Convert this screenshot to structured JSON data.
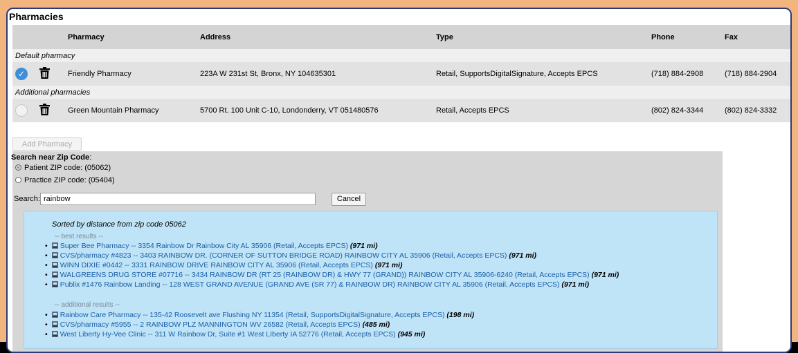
{
  "title": "Pharmacies",
  "columns": [
    "Pharmacy",
    "Address",
    "Type",
    "Phone",
    "Fax"
  ],
  "sections": {
    "default_label": "Default pharmacy",
    "additional_label": "Additional pharmacies"
  },
  "pharmacies": [
    {
      "name": "Friendly Pharmacy",
      "address": "223A W 231st St, Bronx, NY 104635301",
      "type": "Retail, SupportsDigitalSignature, Accepts EPCS",
      "phone": "(718) 884-2908",
      "fax": "(718) 884-2904",
      "selected": true
    },
    {
      "name": "Green Mountain Pharmacy",
      "address": "5700 Rt. 100 Unit C-10, Londonderry, VT 051480576",
      "type": "Retail, Accepts EPCS",
      "phone": "(802) 824-3344",
      "fax": "(802) 824-3332",
      "selected": false
    }
  ],
  "add_pharmacy_label": "Add Pharmacy",
  "search": {
    "heading": "Search near Zip Code",
    "colon": ":",
    "patient_zip": "Patient ZIP code: (05062)",
    "practice_zip": "Practice ZIP code: (05404)",
    "label": "Search:",
    "value": "rainbow",
    "cancel_label": "Cancel"
  },
  "results": {
    "sorted_text": "Sorted by distance from zip code 05062",
    "best_label": "-- best results --",
    "additional_label": "-- additional results --",
    "best": [
      {
        "text": "Super Bee Pharmacy -- 3354 Rainbow Dr Rainbow City AL 35906 (Retail, Accepts EPCS)",
        "distance": "(971 mi)"
      },
      {
        "text": "CVS/pharmacy #4823 -- 3403 RAINBOW DR. (CORNER OF SUTTON BRIDGE ROAD) RAINBOW CITY AL 35906 (Retail, Accepts EPCS)",
        "distance": "(971 mi)"
      },
      {
        "text": "WINN DIXIE #0442 -- 3331 RAINBOW DRIVE RAINBOW CITY AL 35906 (Retail, Accepts EPCS)",
        "distance": "(971 mi)"
      },
      {
        "text": "WALGREENS DRUG STORE #07716 -- 3434 RAINBOW DR (RT 25 (RAINBOW DR) & HWY 77 (GRAND)) RAINBOW CITY AL 35906-6240 (Retail, Accepts EPCS)",
        "distance": "(971 mi)"
      },
      {
        "text": "Publix #1476 Rainbow Landing -- 128 WEST GRAND AVENUE (GRAND AVE (SR 77) & RAINBOW DR) RAINBOW CITY AL 35906 (Retail, Accepts EPCS)",
        "distance": "(971 mi)"
      }
    ],
    "additional": [
      {
        "text": "Rainbow Care Pharmacy -- 135-42 Roosevelt ave Flushing NY 11354 (Retail, SupportsDigitalSignature, Accepts EPCS)",
        "distance": "(198 mi)"
      },
      {
        "text": "CVS/pharmacy #5955 -- 2 RAINBOW PLZ MANNINGTON WV 26582 (Retail, Accepts EPCS)",
        "distance": "(485 mi)"
      },
      {
        "text": "West Liberty Hy-Vee Clinic -- 311 W Rainbow Dr, Suite #1 West LIberty IA 52776 (Retail, Accepts EPCS)",
        "distance": "(945 mi)"
      }
    ]
  },
  "colors": {
    "frame": "#f3b57f",
    "panel_border": "#2b3a78",
    "header_bg": "#d4d4d4",
    "row_bg": "#e2e2e2",
    "check": "#3e8fd8",
    "results_bg": "#bfe3f7",
    "link": "#1a5fa8"
  }
}
